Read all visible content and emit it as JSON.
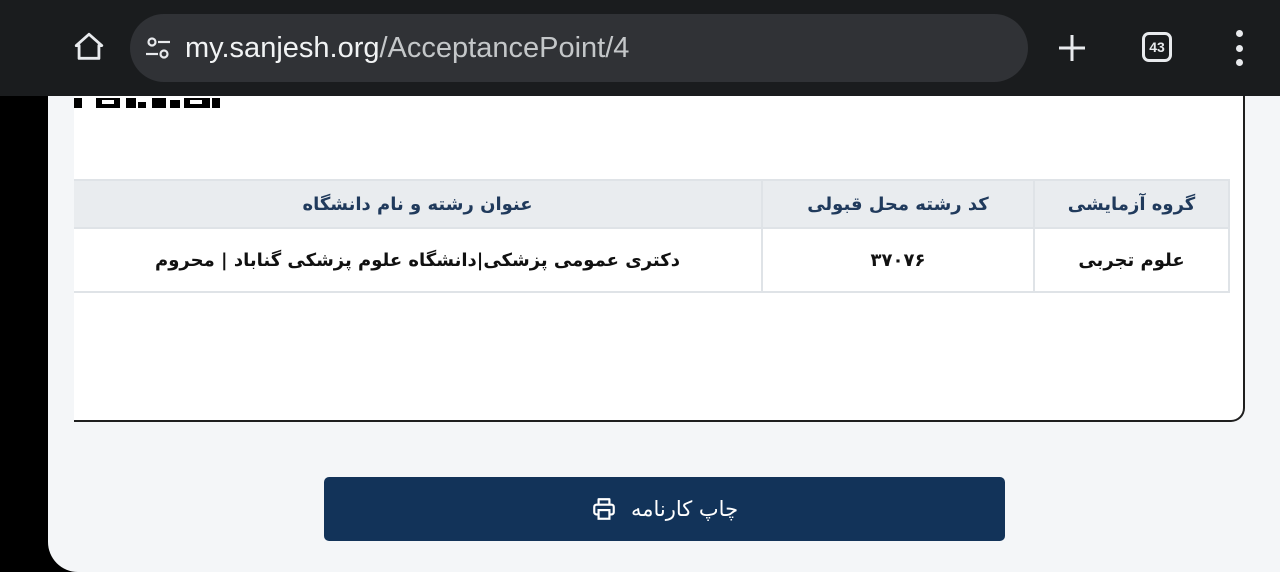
{
  "browser": {
    "url_host": "my.sanjesh.org",
    "url_path": "/AcceptancePoint/4",
    "tab_count": "43",
    "icons": {
      "home": "home-icon",
      "site_settings": "tune-icon",
      "new_tab": "plus-icon",
      "tabs": "tab-count-icon",
      "menu": "more-vert-icon"
    }
  },
  "result_table": {
    "headers": {
      "group": "گروه آزمایشی",
      "code": "کد رشته محل قبولی",
      "title": "عنوان رشته و نام دانشگاه"
    },
    "row": {
      "group": "علوم تجربی",
      "code": "۳۷۰۷۶",
      "title": "دکتری عمومی پزشکی|دانشگاه علوم پزشکی گناباد | محروم"
    }
  },
  "actions": {
    "print_label": "چاپ کارنامه",
    "print_icon": "printer-icon"
  },
  "colors": {
    "browser_bar": "#1a1c1e",
    "url_box": "#303236",
    "header_text": "#203a5c",
    "button_bg": "#123359",
    "table_header_bg": "#e9ecef"
  }
}
